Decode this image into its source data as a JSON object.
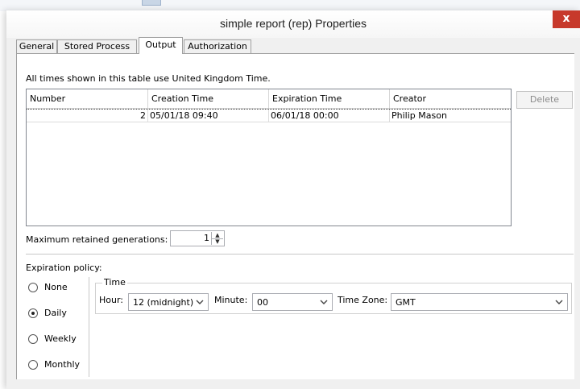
{
  "window": {
    "title": "simple report (rep) Properties",
    "close_glyph": "x"
  },
  "tabs": [
    {
      "label": "General",
      "active": false
    },
    {
      "label": "Stored Process",
      "active": false
    },
    {
      "label": "Output",
      "active": true
    },
    {
      "label": "Authorization",
      "active": false
    }
  ],
  "output": {
    "note": "All times shown in this table use United Kingdom Time.",
    "table": {
      "headers": [
        "Number",
        "Creation Time",
        "Expiration Time",
        "Creator"
      ],
      "rows": [
        {
          "number": "2",
          "creation_time": "05/01/18 09:40",
          "expiration_time": "06/01/18 00:00",
          "creator": "Philip Mason"
        }
      ]
    },
    "delete_label": "Delete",
    "max_generations": {
      "label": "Maximum retained generations:",
      "value": "1"
    },
    "expiration": {
      "label": "Expiration policy:",
      "options": [
        {
          "label": "None",
          "selected": false
        },
        {
          "label": "Daily",
          "selected": true
        },
        {
          "label": "Weekly",
          "selected": false
        },
        {
          "label": "Monthly",
          "selected": false
        }
      ],
      "time_group": {
        "label": "Time",
        "hour_label": "Hour:",
        "hour_value": "12 (midnight)",
        "minute_label": "Minute:",
        "minute_value": "00",
        "timezone_label": "Time Zone:",
        "timezone_value": "GMT"
      }
    }
  }
}
